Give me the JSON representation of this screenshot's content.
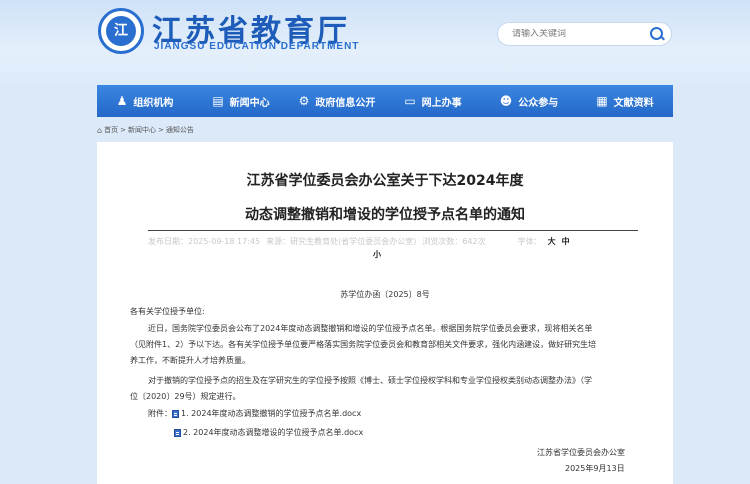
{
  "header": {
    "logo_char": "江",
    "title": "江苏省教育厅",
    "subtitle": "JIANGSU EDUCATION DEPARTMENT",
    "search_placeholder": "请输入关键词"
  },
  "nav": {
    "items": [
      {
        "icon": "♟",
        "label": "组织机构"
      },
      {
        "icon": "▤",
        "label": "新闻中心"
      },
      {
        "icon": "⚙",
        "label": "政府信息公开"
      },
      {
        "icon": "▭",
        "label": "网上办事"
      },
      {
        "icon": "☻",
        "label": "公众参与"
      },
      {
        "icon": "▦",
        "label": "文献资料"
      }
    ]
  },
  "breadcrumb": {
    "home_icon": "⌂",
    "items": [
      "首页",
      "新闻中心",
      "通知公告"
    ],
    "separator": ">"
  },
  "article": {
    "title_line1": "江苏省学位委员会办公室关于下达2024年度",
    "title_line2": "动态调整撤销和增设的学位授予点名单的通知",
    "meta_date": "发布日期：2025-09-18 17:45",
    "meta_source": "来源：研究生教育处(省学位委员会办公室)",
    "meta_views": "浏览次数：642次",
    "font_size_label": "字体：",
    "font_large": "大",
    "font_medium": "中",
    "font_small": "小",
    "doc_number": "苏学位办函〔2025〕8号",
    "salutation": "各有关学位授予单位:",
    "para1_line1": "近日，国务院学位委员会公布了2024年度动态调整撤销和增设的学位授予点名单。根据国务院学位委员会要求，现将相关名单",
    "para1_line2": "（见附件1、2）予以下达。各有关学位授予单位要严格落实国务院学位委员会和教育部相关文件要求，强化内涵建设，做好研究生培",
    "para1_line3": "养工作，不断提升人才培养质量。",
    "para2_line1": "对于撤销的学位授予点的招生及在学研究生的学位授予按照《博士、硕士学位授权学科和专业学位授权类别动态调整办法》（学",
    "para2_line2": "位〔2020〕29号）规定进行。",
    "attachments_label": "附件：",
    "attachment1": "1. 2024年度动态调整撤销的学位授予点名单.docx",
    "attachment2": "2. 2024年度动态调整增设的学位授予点名单.docx",
    "signer": "江苏省学位委员会办公室",
    "sign_date": "2025年9月13日"
  }
}
